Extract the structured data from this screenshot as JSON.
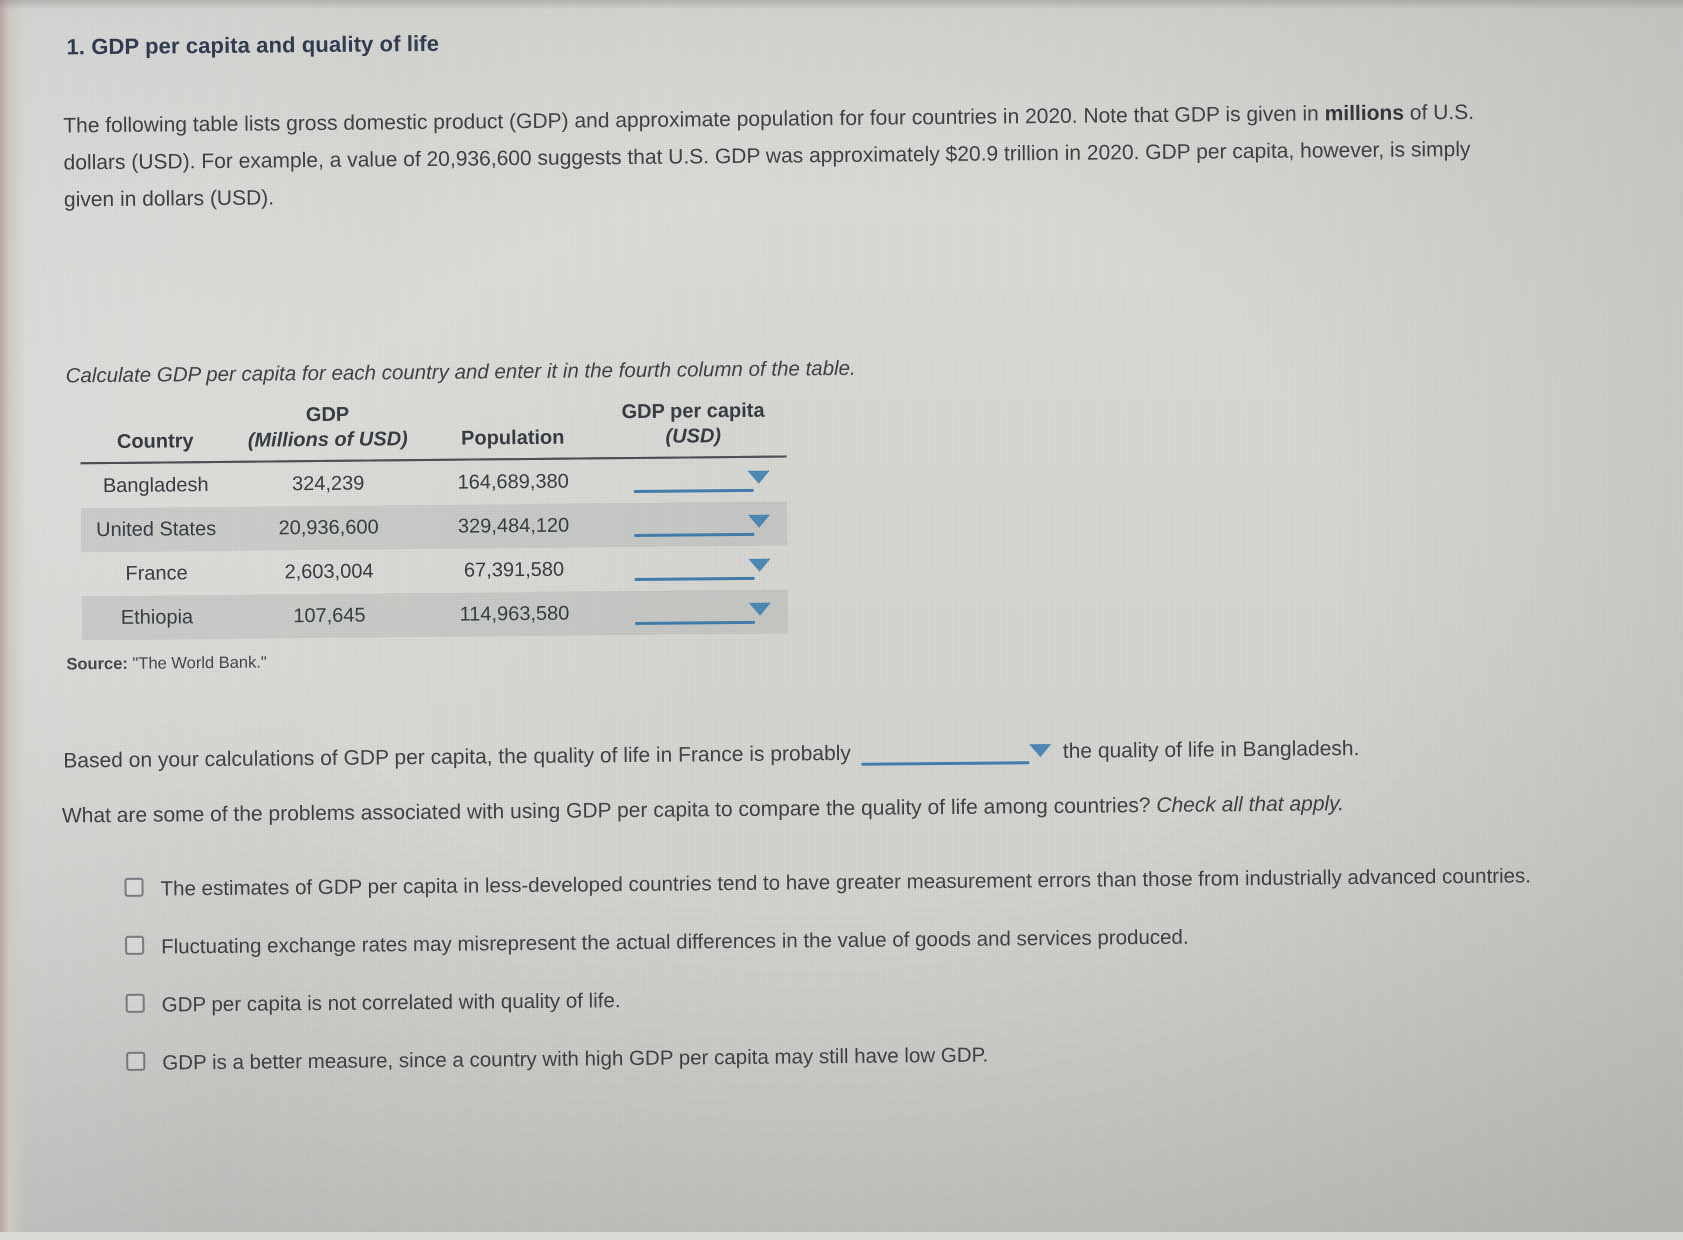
{
  "heading": "1. GDP per capita and quality of life",
  "intro": {
    "part1": "The following table lists gross domestic product (GDP) and approximate population for four countries in 2020. Note that GDP is given in ",
    "bold": "millions",
    "part2": " of U.S. dollars (USD). For example, a value of 20,936,600 suggests that U.S. GDP was approximately $20.9 trillion in 2020. GDP per capita, however, is simply given in dollars (USD)."
  },
  "instruction": "Calculate GDP per capita for each country and enter it in the fourth column of the table.",
  "table": {
    "headers": {
      "country": "Country",
      "gdp_line1": "GDP",
      "gdp_line2": "(Millions of USD)",
      "population": "Population",
      "percapita_line1": "GDP per capita",
      "percapita_line2": "(USD)"
    },
    "rows": [
      {
        "country": "Bangladesh",
        "gdp": "324,239",
        "population": "164,689,380",
        "per_capita": ""
      },
      {
        "country": "United States",
        "gdp": "20,936,600",
        "population": "329,484,120",
        "per_capita": ""
      },
      {
        "country": "France",
        "gdp": "2,603,004",
        "population": "67,391,580",
        "per_capita": ""
      },
      {
        "country": "Ethiopia",
        "gdp": "107,645",
        "population": "114,963,580",
        "per_capita": ""
      }
    ]
  },
  "source": {
    "label": "Source:",
    "text": "\"The World Bank.\""
  },
  "followup": {
    "before_dropdown": "Based on your calculations of GDP per capita, the quality of life in France is probably",
    "dropdown_value": "",
    "after_dropdown": "the quality of life in Bangladesh."
  },
  "question": {
    "text": "What are some of the problems associated with using GDP per capita to compare the quality of life among countries? ",
    "italic": "Check all that apply."
  },
  "options": [
    {
      "label": "The estimates of GDP per capita in less-developed countries tend to have greater measurement errors than those from industrially advanced countries.",
      "checked": false
    },
    {
      "label": "Fluctuating exchange rates may misrepresent the actual differences in the value of goods and services produced.",
      "checked": false
    },
    {
      "label": "GDP per capita is not correlated with quality of life.",
      "checked": false
    },
    {
      "label": "GDP is a better measure, since a country with high GDP per capita may still have low GDP.",
      "checked": false
    }
  ],
  "colors": {
    "accent": "#3f7cab",
    "caret": "#4a86b4",
    "heading": "#2e3a52",
    "text": "#3b3e43",
    "background": "#d7d8d3"
  }
}
